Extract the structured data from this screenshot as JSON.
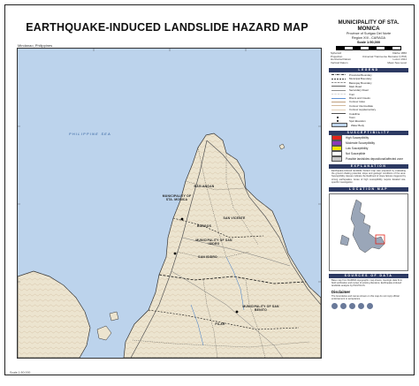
{
  "title": "EARTHQUAKE-INDUCED LANDSLIDE HAZARD MAP",
  "region_label": "Mindanao, Philippines",
  "footnote": "Scale 1:50,000",
  "panel": {
    "municipality": "MUNICIPALITY OF STA. MONICA",
    "province": "Province of Surigao Del Norte",
    "region": "Region XIII - CARAGA",
    "scale": "Scale 1:50,000",
    "projection": [
      [
        "Spheroid",
        "Clarke 1866"
      ],
      [
        "Projection",
        "Universal Transverse Mercator (UTM)"
      ],
      [
        "Horizontal Datum",
        "Luzon 1911"
      ],
      [
        "Vertical Datum",
        "Mean Sea Level"
      ]
    ],
    "legend_header": "LEGEND",
    "legend_items": [
      {
        "label": "Provincial Boundary",
        "color": "#000000",
        "style": "dashdot"
      },
      {
        "label": "Municipal Boundary",
        "color": "#000000",
        "style": "dash"
      },
      {
        "label": "Barangay Boundary",
        "color": "#000000",
        "style": "dot"
      },
      {
        "label": "Main Road",
        "color": "#444444",
        "style": "solid"
      },
      {
        "label": "Secondary Road",
        "color": "#777777",
        "style": "solid"
      },
      {
        "label": "Trail",
        "color": "#999999",
        "style": "dot"
      },
      {
        "label": "Rivers and Creeks",
        "color": "#3a78c8",
        "style": "solid"
      },
      {
        "label": "Contour index",
        "color": "#b08860",
        "style": "solid"
      },
      {
        "label": "Contour intermediate",
        "color": "#c8a882",
        "style": "solid"
      },
      {
        "label": "Contour supplementary",
        "color": "#d8c0a0",
        "style": "solid"
      },
      {
        "label": "Coastline",
        "color": "#222222",
        "style": "solid"
      },
      {
        "label": "Town",
        "color": "#000000",
        "style": "point"
      },
      {
        "label": "Spot Elevation",
        "color": "#000000",
        "style": "point"
      },
      {
        "label": "Water Body",
        "color": "#bcd3ec",
        "style": "fill"
      }
    ],
    "susceptibility_header": "SUSCEPTIBILITY",
    "susceptibility": [
      {
        "label": "High Susceptibility",
        "color": "#e2231a"
      },
      {
        "label": "Moderate Susceptibility",
        "color": "#8a3ab9"
      },
      {
        "label": "Low Susceptibility",
        "color": "#f2e600"
      },
      {
        "label": "Not Susceptible",
        "color": "#ffffff"
      },
      {
        "label": "Possible landslides depositional/affected zone",
        "color": "#c8c8c8"
      }
    ],
    "disclaimer_header": "EXPLANATION",
    "explanation": "Earthquake-induced landslide hazard map was prepared by evaluating the ground shaking potential, slope and geologic conditions of the area. Susceptibility classes indicate the likelihood of slope failures triggered by strong earthquakes. Areas of high susceptibility require detailed site-specific investigation.",
    "location_header": "LOCATION MAP",
    "sources_header": "SOURCES OF DATA",
    "sources": "Base map from NAMRIA topographic map sheets; Geologic data from field verification and review of existing literature; Earthquake-induced landslide analysis by PHIVOLCS.",
    "disclaimer_title": "Disclaimer",
    "disclaimer": "The boundaries and names shown on this map do not imply official endorsement or acceptance."
  },
  "map": {
    "sea_label": "PHILIPPINE SEA",
    "municipality_labels": [
      "MUNICIPALITY OF STA. MONICA",
      "BAG-ANGAN",
      "SAN VICENTE",
      "BURGOS",
      "MUNICIPALITY OF SAN ISIDRO",
      "SAN ISIDRO",
      "MUNICIPALITY OF SAN BENITO",
      "PILAR"
    ]
  }
}
